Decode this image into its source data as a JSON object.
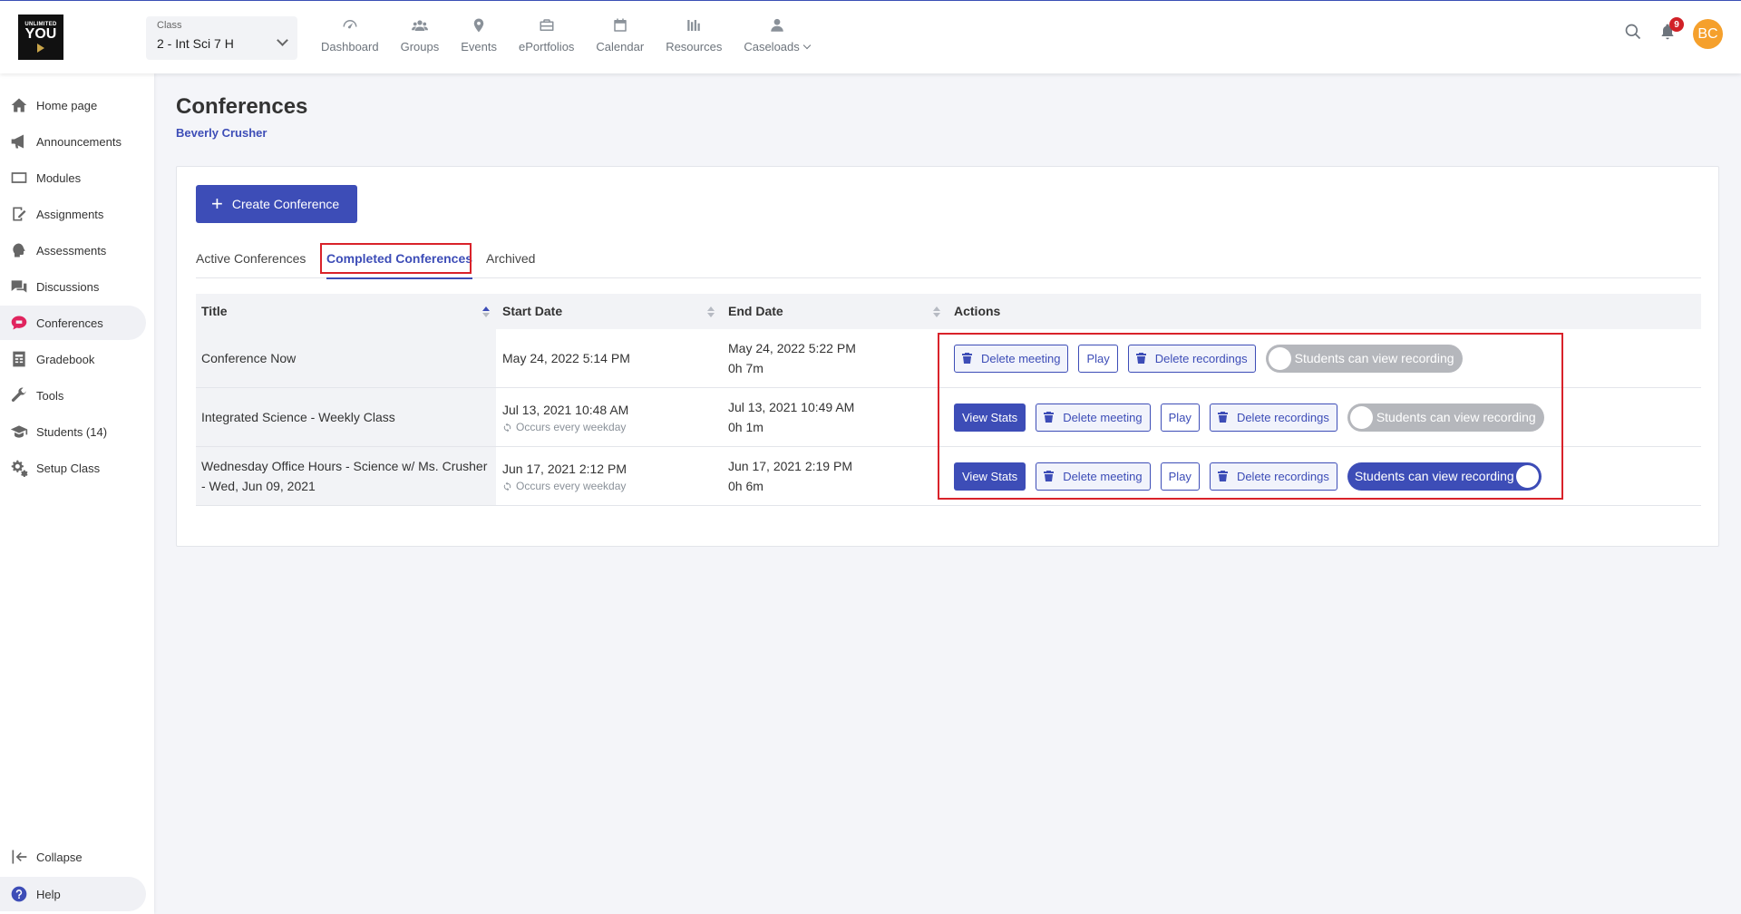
{
  "logo": {
    "line1": "UNLIMITED",
    "line2": "YOU"
  },
  "class_select": {
    "label": "Class",
    "value": "2 - Int Sci 7 H"
  },
  "nav": [
    {
      "label": "Dashboard",
      "icon": "dashboard-icon"
    },
    {
      "label": "Groups",
      "icon": "groups-icon"
    },
    {
      "label": "Events",
      "icon": "location-pin-icon"
    },
    {
      "label": "ePortfolios",
      "icon": "briefcase-icon"
    },
    {
      "label": "Calendar",
      "icon": "calendar-icon"
    },
    {
      "label": "Resources",
      "icon": "resources-icon"
    },
    {
      "label": "Caseloads",
      "icon": "person-icon"
    }
  ],
  "header": {
    "notification_count": "9",
    "avatar_initials": "BC"
  },
  "sidebar": {
    "items": [
      {
        "label": "Home page",
        "icon": "home-icon"
      },
      {
        "label": "Announcements",
        "icon": "megaphone-icon"
      },
      {
        "label": "Modules",
        "icon": "modules-icon"
      },
      {
        "label": "Assignments",
        "icon": "assignment-icon"
      },
      {
        "label": "Assessments",
        "icon": "assessment-icon"
      },
      {
        "label": "Discussions",
        "icon": "discussion-icon"
      },
      {
        "label": "Conferences",
        "icon": "conference-icon",
        "active": true
      },
      {
        "label": "Gradebook",
        "icon": "gradebook-icon"
      },
      {
        "label": "Tools",
        "icon": "wrench-icon"
      },
      {
        "label": "Students (14)",
        "icon": "students-icon"
      },
      {
        "label": "Setup Class",
        "icon": "gears-icon"
      }
    ],
    "collapse_label": "Collapse",
    "help_label": "Help"
  },
  "page": {
    "title": "Conferences",
    "subtitle": "Beverly Crusher"
  },
  "create_button": "Create Conference",
  "tabs": [
    {
      "label": "Active Conferences"
    },
    {
      "label": "Completed Conferences",
      "active": true
    },
    {
      "label": "Archived"
    }
  ],
  "table": {
    "headers": {
      "title": "Title",
      "start": "Start Date",
      "end": "End Date",
      "actions": "Actions"
    },
    "rows": [
      {
        "title": "Conference Now",
        "start": "May 24, 2022 5:14 PM",
        "recurrence": "",
        "end": "May 24, 2022 5:22 PM",
        "duration": "0h 7m",
        "view_stats": "",
        "delete_meeting": "Delete meeting",
        "play": "Play",
        "delete_recordings": "Delete recordings",
        "toggle_label": "Students can view recording",
        "toggle_on": false
      },
      {
        "title": "Integrated Science - Weekly Class",
        "start": "Jul 13, 2021 10:48 AM",
        "recurrence": "Occurs every weekday",
        "end": "Jul 13, 2021 10:49 AM",
        "duration": "0h 1m",
        "view_stats": "View Stats",
        "delete_meeting": "Delete meeting",
        "play": "Play",
        "delete_recordings": "Delete recordings",
        "toggle_label": "Students can view recording",
        "toggle_on": false
      },
      {
        "title": "Wednesday Office Hours - Science w/ Ms. Crusher - Wed, Jun 09, 2021",
        "start": "Jun 17, 2021 2:12 PM",
        "recurrence": "Occurs every weekday",
        "end": "Jun 17, 2021 2:19 PM",
        "duration": "0h 6m",
        "view_stats": "View Stats",
        "delete_meeting": "Delete meeting",
        "play": "Play",
        "delete_recordings": "Delete recordings",
        "toggle_label": "Students can view recording",
        "toggle_on": true
      }
    ]
  },
  "colors": {
    "accent": "#3d4db7",
    "highlight": "#d9222a",
    "active_icon": "#e0245e",
    "avatar": "#f5a02c"
  }
}
